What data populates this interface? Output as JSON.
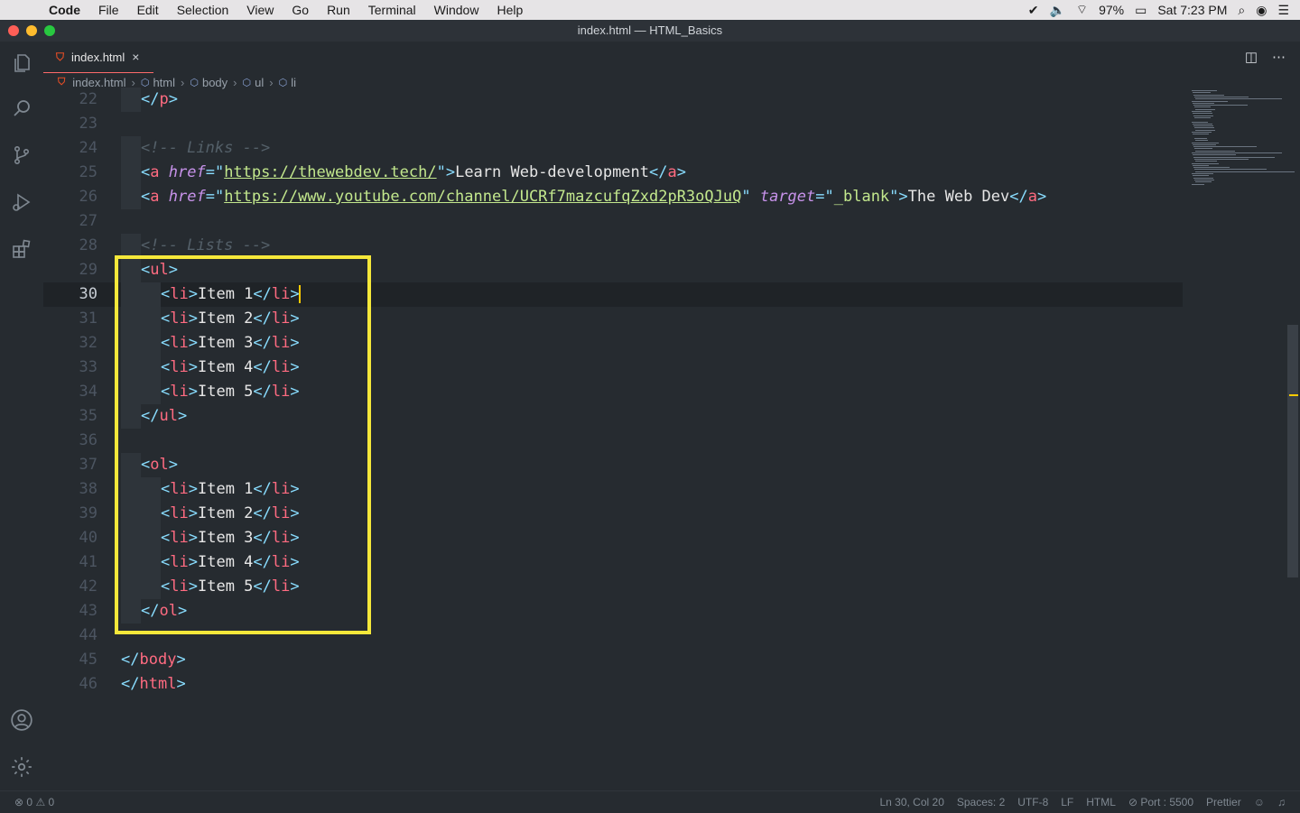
{
  "menubar": {
    "app_name": "Code",
    "items": [
      "File",
      "Edit",
      "Selection",
      "View",
      "Go",
      "Run",
      "Terminal",
      "Window",
      "Help"
    ],
    "battery": "97%",
    "clock": "Sat 7:23 PM"
  },
  "window": {
    "title": "index.html — HTML_Basics"
  },
  "activity_bar": [
    "files-icon",
    "search-icon",
    "source-control-icon",
    "run-debug-icon",
    "extensions-icon",
    "account-icon",
    "settings-gear-icon"
  ],
  "tab": {
    "label": "index.html",
    "close": "×"
  },
  "breadcrumb": {
    "file": "index.html",
    "items": [
      "html",
      "body",
      "ul",
      "li"
    ]
  },
  "editor": {
    "lines": [
      {
        "n": "22",
        "html": "<span class=\"c-punc\">&lt;/</span><span class=\"c-tag\">p</span><span class=\"c-punc\">&gt;</span>",
        "indent": 1
      },
      {
        "n": "23",
        "html": "",
        "indent": 0
      },
      {
        "n": "24",
        "html": "<span class=\"c-cmt\">&lt;!-- Links --&gt;</span>",
        "indent": 1
      },
      {
        "n": "25",
        "html": "<span class=\"c-punc\">&lt;</span><span class=\"c-tag\">a</span> <span class=\"c-attr\">href</span><span class=\"c-punc\">=\"</span><span class=\"c-url\">https://thewebdev.tech/</span><span class=\"c-punc\">\"&gt;</span><span class=\"c-text\">Learn Web-development</span><span class=\"c-punc\">&lt;/</span><span class=\"c-tag\">a</span><span class=\"c-punc\">&gt;</span>",
        "indent": 1
      },
      {
        "n": "26",
        "html": "<span class=\"c-punc\">&lt;</span><span class=\"c-tag\">a</span> <span class=\"c-attr\">href</span><span class=\"c-punc\">=\"</span><span class=\"c-url\">https://www.youtube.com/channel/UCRf7mazcufqZxd2pR3oQJuQ</span><span class=\"c-punc\">\"</span> <span class=\"c-attr\">target</span><span class=\"c-punc\">=\"</span><span class=\"c-str\">_blank</span><span class=\"c-punc\">\"&gt;</span><span class=\"c-text\">The Web Dev</span><span class=\"c-punc\">&lt;/</span><span class=\"c-tag\">a</span><span class=\"c-punc\">&gt;</span>",
        "indent": 1
      },
      {
        "n": "27",
        "html": "",
        "indent": 0
      },
      {
        "n": "28",
        "html": "<span class=\"c-cmt\">&lt;!-- Lists --&gt;</span>",
        "indent": 1
      },
      {
        "n": "29",
        "html": "<span class=\"c-punc\">&lt;</span><span class=\"c-tag\">ul</span><span class=\"c-punc\">&gt;</span>",
        "indent": 1
      },
      {
        "n": "30",
        "html": "<span class=\"c-punc\">&lt;</span><span class=\"c-tag\">li</span><span class=\"c-punc\">&gt;</span><span class=\"c-text\">Item 1</span><span class=\"c-punc\">&lt;/</span><span class=\"c-tag\">li</span><span class=\"c-punc\">&gt;</span><span class=\"cursor\"></span>",
        "indent": 2
      },
      {
        "n": "31",
        "html": "<span class=\"c-punc\">&lt;</span><span class=\"c-tag\">li</span><span class=\"c-punc\">&gt;</span><span class=\"c-text\">Item 2</span><span class=\"c-punc\">&lt;/</span><span class=\"c-tag\">li</span><span class=\"c-punc\">&gt;</span>",
        "indent": 2
      },
      {
        "n": "32",
        "html": "<span class=\"c-punc\">&lt;</span><span class=\"c-tag\">li</span><span class=\"c-punc\">&gt;</span><span class=\"c-text\">Item 3</span><span class=\"c-punc\">&lt;/</span><span class=\"c-tag\">li</span><span class=\"c-punc\">&gt;</span>",
        "indent": 2
      },
      {
        "n": "33",
        "html": "<span class=\"c-punc\">&lt;</span><span class=\"c-tag\">li</span><span class=\"c-punc\">&gt;</span><span class=\"c-text\">Item 4</span><span class=\"c-punc\">&lt;/</span><span class=\"c-tag\">li</span><span class=\"c-punc\">&gt;</span>",
        "indent": 2
      },
      {
        "n": "34",
        "html": "<span class=\"c-punc\">&lt;</span><span class=\"c-tag\">li</span><span class=\"c-punc\">&gt;</span><span class=\"c-text\">Item 5</span><span class=\"c-punc\">&lt;/</span><span class=\"c-tag\">li</span><span class=\"c-punc\">&gt;</span>",
        "indent": 2
      },
      {
        "n": "35",
        "html": "<span class=\"c-punc\">&lt;/</span><span class=\"c-tag\">ul</span><span class=\"c-punc\">&gt;</span>",
        "indent": 1
      },
      {
        "n": "36",
        "html": "",
        "indent": 0
      },
      {
        "n": "37",
        "html": "<span class=\"c-punc\">&lt;</span><span class=\"c-tag\">ol</span><span class=\"c-punc\">&gt;</span>",
        "indent": 1
      },
      {
        "n": "38",
        "html": "<span class=\"c-punc\">&lt;</span><span class=\"c-tag\">li</span><span class=\"c-punc\">&gt;</span><span class=\"c-text\">Item 1</span><span class=\"c-punc\">&lt;/</span><span class=\"c-tag\">li</span><span class=\"c-punc\">&gt;</span>",
        "indent": 2
      },
      {
        "n": "39",
        "html": "<span class=\"c-punc\">&lt;</span><span class=\"c-tag\">li</span><span class=\"c-punc\">&gt;</span><span class=\"c-text\">Item 2</span><span class=\"c-punc\">&lt;/</span><span class=\"c-tag\">li</span><span class=\"c-punc\">&gt;</span>",
        "indent": 2
      },
      {
        "n": "40",
        "html": "<span class=\"c-punc\">&lt;</span><span class=\"c-tag\">li</span><span class=\"c-punc\">&gt;</span><span class=\"c-text\">Item 3</span><span class=\"c-punc\">&lt;/</span><span class=\"c-tag\">li</span><span class=\"c-punc\">&gt;</span>",
        "indent": 2
      },
      {
        "n": "41",
        "html": "<span class=\"c-punc\">&lt;</span><span class=\"c-tag\">li</span><span class=\"c-punc\">&gt;</span><span class=\"c-text\">Item 4</span><span class=\"c-punc\">&lt;/</span><span class=\"c-tag\">li</span><span class=\"c-punc\">&gt;</span>",
        "indent": 2
      },
      {
        "n": "42",
        "html": "<span class=\"c-punc\">&lt;</span><span class=\"c-tag\">li</span><span class=\"c-punc\">&gt;</span><span class=\"c-text\">Item 5</span><span class=\"c-punc\">&lt;/</span><span class=\"c-tag\">li</span><span class=\"c-punc\">&gt;</span>",
        "indent": 2
      },
      {
        "n": "43",
        "html": "<span class=\"c-punc\">&lt;/</span><span class=\"c-tag\">ol</span><span class=\"c-punc\">&gt;</span>",
        "indent": 1
      },
      {
        "n": "44",
        "html": "",
        "indent": 0
      },
      {
        "n": "45",
        "html": "<span class=\"c-punc\">&lt;/</span><span class=\"c-tag\">body</span><span class=\"c-punc\">&gt;</span>",
        "indent": 0
      },
      {
        "n": "46",
        "html": "<span class=\"c-punc\">&lt;/</span><span class=\"c-tag\">html</span><span class=\"c-punc\">&gt;</span>",
        "indent": 0
      }
    ],
    "current_line": "30",
    "highlight_color": "#f5e83a"
  },
  "status": {
    "errors": "0",
    "warnings": "0",
    "position": "Ln 30, Col 20",
    "spaces": "Spaces: 2",
    "encoding": "UTF-8",
    "eol": "LF",
    "language": "HTML",
    "port": "Port : 5500",
    "formatter": "Prettier"
  },
  "colors": {
    "accent_tab": "#ff6b6b",
    "cursor": "#ffcc00"
  }
}
